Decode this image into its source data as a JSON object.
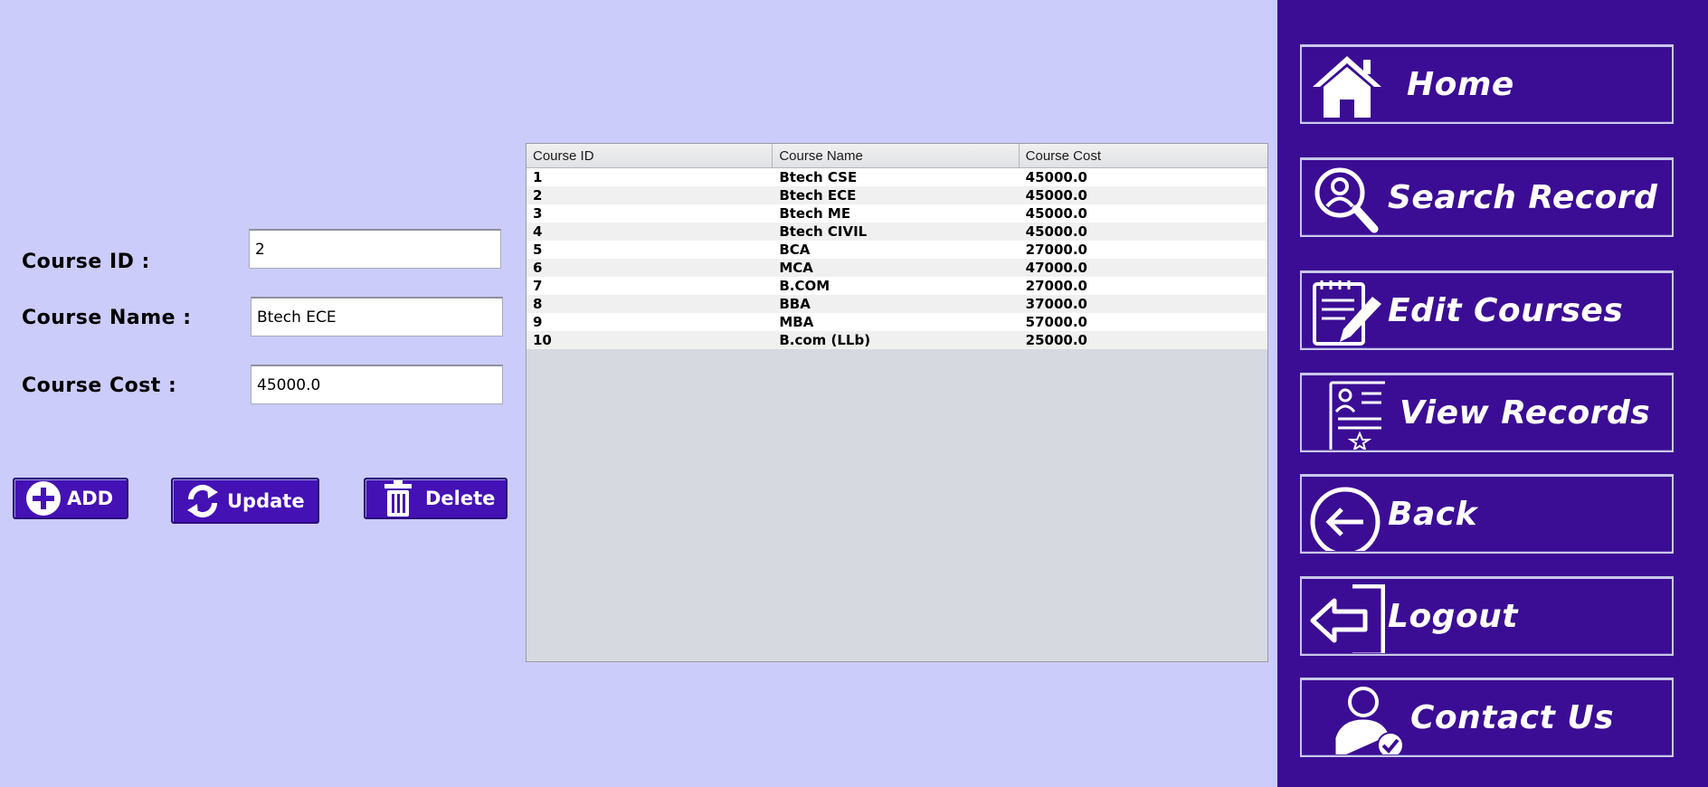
{
  "form": {
    "course_id": {
      "label": "Course ID :",
      "value": "2"
    },
    "course_name": {
      "label": "Course Name :",
      "value": "Btech ECE"
    },
    "course_cost": {
      "label": "Course Cost :",
      "value": "45000.0"
    }
  },
  "buttons": {
    "add": "ADD",
    "update": "Update",
    "delete": "Delete"
  },
  "table": {
    "headers": [
      "Course ID",
      "Course Name",
      "Course Cost"
    ],
    "rows": [
      [
        "1",
        "Btech CSE",
        "45000.0"
      ],
      [
        "2",
        "Btech ECE",
        "45000.0"
      ],
      [
        "3",
        "Btech ME",
        "45000.0"
      ],
      [
        "4",
        "Btech CIVIL",
        "45000.0"
      ],
      [
        "5",
        "BCA",
        "27000.0"
      ],
      [
        "6",
        "MCA",
        "47000.0"
      ],
      [
        "7",
        "B.COM",
        "27000.0"
      ],
      [
        "8",
        "BBA",
        "37000.0"
      ],
      [
        "9",
        "MBA",
        "57000.0"
      ],
      [
        "10",
        "B.com (LLb)",
        "25000.0"
      ]
    ]
  },
  "sidebar": {
    "items": [
      {
        "label": "Home",
        "icon": "home-icon"
      },
      {
        "label": "Search Record",
        "icon": "search-user-icon"
      },
      {
        "label": "Edit Courses",
        "icon": "edit-notepad-icon"
      },
      {
        "label": "View Records",
        "icon": "certificate-icon"
      },
      {
        "label": "Back",
        "icon": "back-arrow-icon"
      },
      {
        "label": "Logout",
        "icon": "logout-icon"
      },
      {
        "label": "Contact Us",
        "icon": "contact-user-icon"
      }
    ]
  },
  "colors": {
    "background": "#ccccfb",
    "sidebar": "#3b0d94",
    "button": "#4411b5",
    "table_empty": "#d6d9df"
  }
}
